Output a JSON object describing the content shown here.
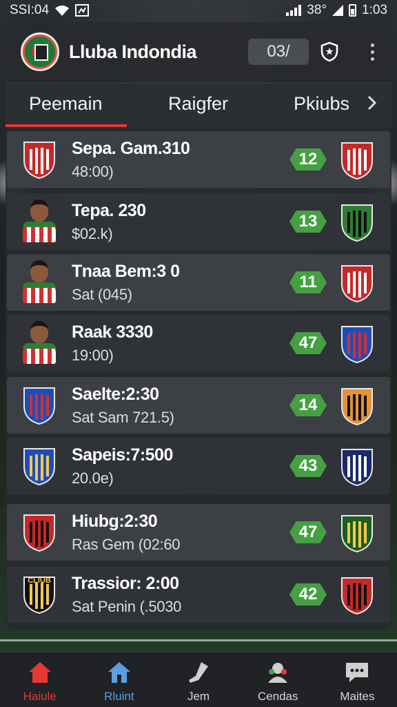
{
  "status_bar": {
    "left_text": "SSI:04",
    "battery_text": "38°",
    "time": "1:03"
  },
  "header": {
    "app_title": "Lluba Indondia",
    "counter_value": "03/"
  },
  "tabs": [
    {
      "label": "Peemain",
      "active": true
    },
    {
      "label": "Raigfer",
      "active": false
    },
    {
      "label": "Pkiubs",
      "active": false
    }
  ],
  "rows": [
    {
      "title": "Sepa. Gam.310",
      "subtitle": "48:00)",
      "badge": "12",
      "left": "crest-red-white",
      "right": "crest-red-white"
    },
    {
      "title": "Tepa. 230",
      "subtitle": "$02.k)",
      "badge": "13",
      "left": "player",
      "right": "crest-green-black"
    },
    {
      "title": "Tnaa Bem:3 0",
      "subtitle": "Sat (045)",
      "badge": "11",
      "left": "player",
      "right": "crest-red-white"
    },
    {
      "title": "Raak 3330",
      "subtitle": "19:00)",
      "badge": "47",
      "left": "player",
      "right": "crest-blue-red"
    },
    {
      "title": "Saelte:2:30",
      "subtitle": "Sat Sam 721.5)",
      "badge": "14",
      "left": "crest-blue-red",
      "right": "crest-orange-black"
    },
    {
      "title": "Sapeis:7:500",
      "subtitle": "20.0e)",
      "badge": "43",
      "left": "crest-blue-gold",
      "right": "crest-navy-white"
    },
    {
      "title": "Hiubg:2:30",
      "subtitle": "Ras Gem (02:60",
      "badge": "47",
      "left": "crest-red-black",
      "right": "crest-green-gold"
    },
    {
      "title": "Trassior: 2:00",
      "subtitle": "Sat Penin (.5030",
      "badge": "42",
      "left": "crest-club-yellow",
      "right": "crest-red-black"
    }
  ],
  "left_crest_text": "CLIUB",
  "nav": [
    {
      "label": "Haiule",
      "active": true
    },
    {
      "label": "Rluint",
      "active": false
    },
    {
      "label": "Jem",
      "active": false
    },
    {
      "label": "Cendas",
      "active": false
    },
    {
      "label": "Maites",
      "active": false
    }
  ],
  "colors": {
    "accent_red": "#e53935",
    "badge_green": "#46a043",
    "nav_active_blue": "#5aa0e0"
  }
}
